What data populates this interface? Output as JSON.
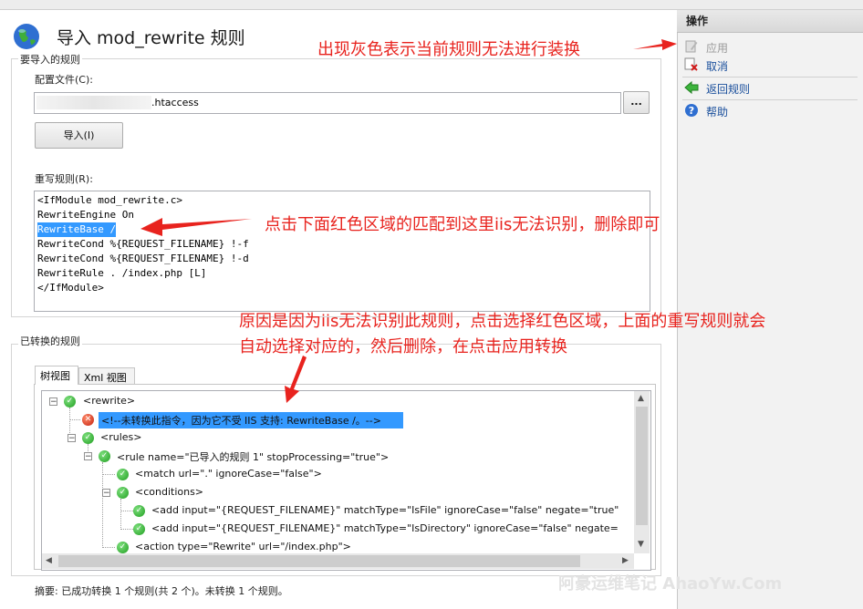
{
  "dialog": {
    "title": "导入 mod_rewrite 规则",
    "import_group_label": "要导入的规则",
    "config_label": "配置文件(C):",
    "config_value": ".htaccess",
    "browse_label": "...",
    "import_button": "导入(I)",
    "rules_label": "重写规则(R):",
    "rules_lines": [
      "<IfModule mod_rewrite.c>",
      "RewriteEngine On",
      "RewriteBase /",
      "RewriteCond %{REQUEST_FILENAME} !-f",
      "RewriteCond %{REQUEST_FILENAME} !-d",
      "RewriteRule . /index.php [L]",
      "</IfModule>"
    ],
    "converted_group_label": "已转换的规则",
    "tabs": [
      "树视图",
      "Xml 视图"
    ],
    "tree": [
      "<rewrite>",
      "<!--未转换此指令，因为它不受 IIS 支持: RewriteBase /。-->",
      "<rules>",
      "<rule name=\"已导入的规则 1\" stopProcessing=\"true\">",
      "<match url=\".\" ignoreCase=\"false\">",
      "<conditions>",
      "<add input=\"{REQUEST_FILENAME}\" matchType=\"IsFile\" ignoreCase=\"false\" negate=\"true\"",
      "<add input=\"{REQUEST_FILENAME}\" matchType=\"IsDirectory\" ignoreCase=\"false\" negate=",
      "<action type=\"Rewrite\" url=\"/index.php\">"
    ],
    "summary": "摘要: 已成功转换 1 个规则(共 2 个)。未转换 1 个规则。"
  },
  "sidebar": {
    "header": "操作",
    "actions": [
      {
        "label": "应用",
        "icon": "apply-icon",
        "enabled": false
      },
      {
        "label": "取消",
        "icon": "cancel-icon",
        "enabled": true
      },
      {
        "label": "返回规则",
        "icon": "back-arrow-icon",
        "enabled": true
      },
      {
        "label": "帮助",
        "icon": "help-icon",
        "enabled": true
      }
    ]
  },
  "annotations": {
    "a1": "出现灰色表示当前规则无法进行装换",
    "a2": "点击下面红色区域的匹配到这里iis无法识别，删除即可",
    "a3_line1": "原因是因为iis无法识别此规则，点击选择红色区域，上面的重写规则就会",
    "a3_line2": "自动选择对应的，然后删除，在点击应用转换"
  },
  "watermark": "阿豪运维笔记 AhaoYw.Com",
  "colors": {
    "annotation": "#e8231e",
    "selection": "#3399ff",
    "link": "#1a4f9c"
  }
}
